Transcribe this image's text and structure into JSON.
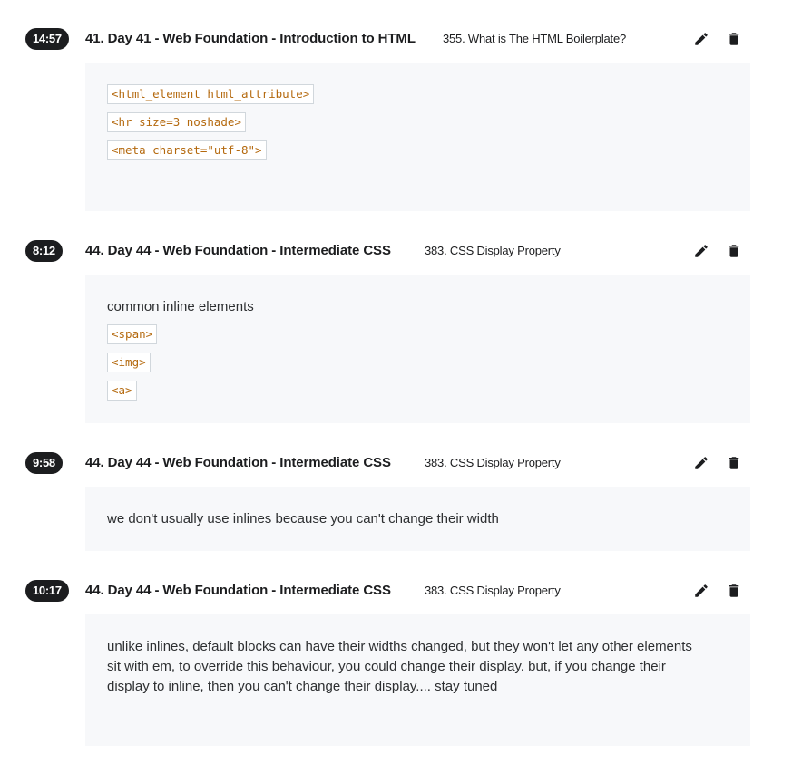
{
  "notes": [
    {
      "time": "14:57",
      "section": "41. Day 41 - Web Foundation - Introduction to HTML",
      "lecture": "355. What is The HTML Boilerplate?",
      "content": {
        "code": [
          "<html_element html_attribute>",
          "<hr size=3 noshade>",
          "<meta charset=\"utf-8\">"
        ]
      }
    },
    {
      "time": "8:12",
      "section": "44. Day 44 - Web Foundation - Intermediate CSS",
      "lecture": "383. CSS Display Property",
      "content": {
        "text": "common inline elements",
        "code": [
          "<span>",
          "<img>",
          "<a>"
        ]
      }
    },
    {
      "time": "9:58",
      "section": "44. Day 44 - Web Foundation - Intermediate CSS",
      "lecture": "383. CSS Display Property",
      "content": {
        "text": "we don't usually use inlines because you can't change their width"
      }
    },
    {
      "time": "10:17",
      "section": "44. Day 44 - Web Foundation - Intermediate CSS",
      "lecture": "383. CSS Display Property",
      "content": {
        "text": "unlike inlines, default blocks can have their widths changed, but they won't let any other elements sit with em, to override this behaviour, you could change their display. but, if you change their display to inline, then you can't change their display.... stay tuned"
      }
    }
  ],
  "icons": {
    "edit": "pencil-icon",
    "delete": "trash-icon"
  },
  "colors": {
    "badge_bg": "#1c1d1f",
    "note_bg": "#f7f8fa",
    "code_text": "#b4690e"
  }
}
